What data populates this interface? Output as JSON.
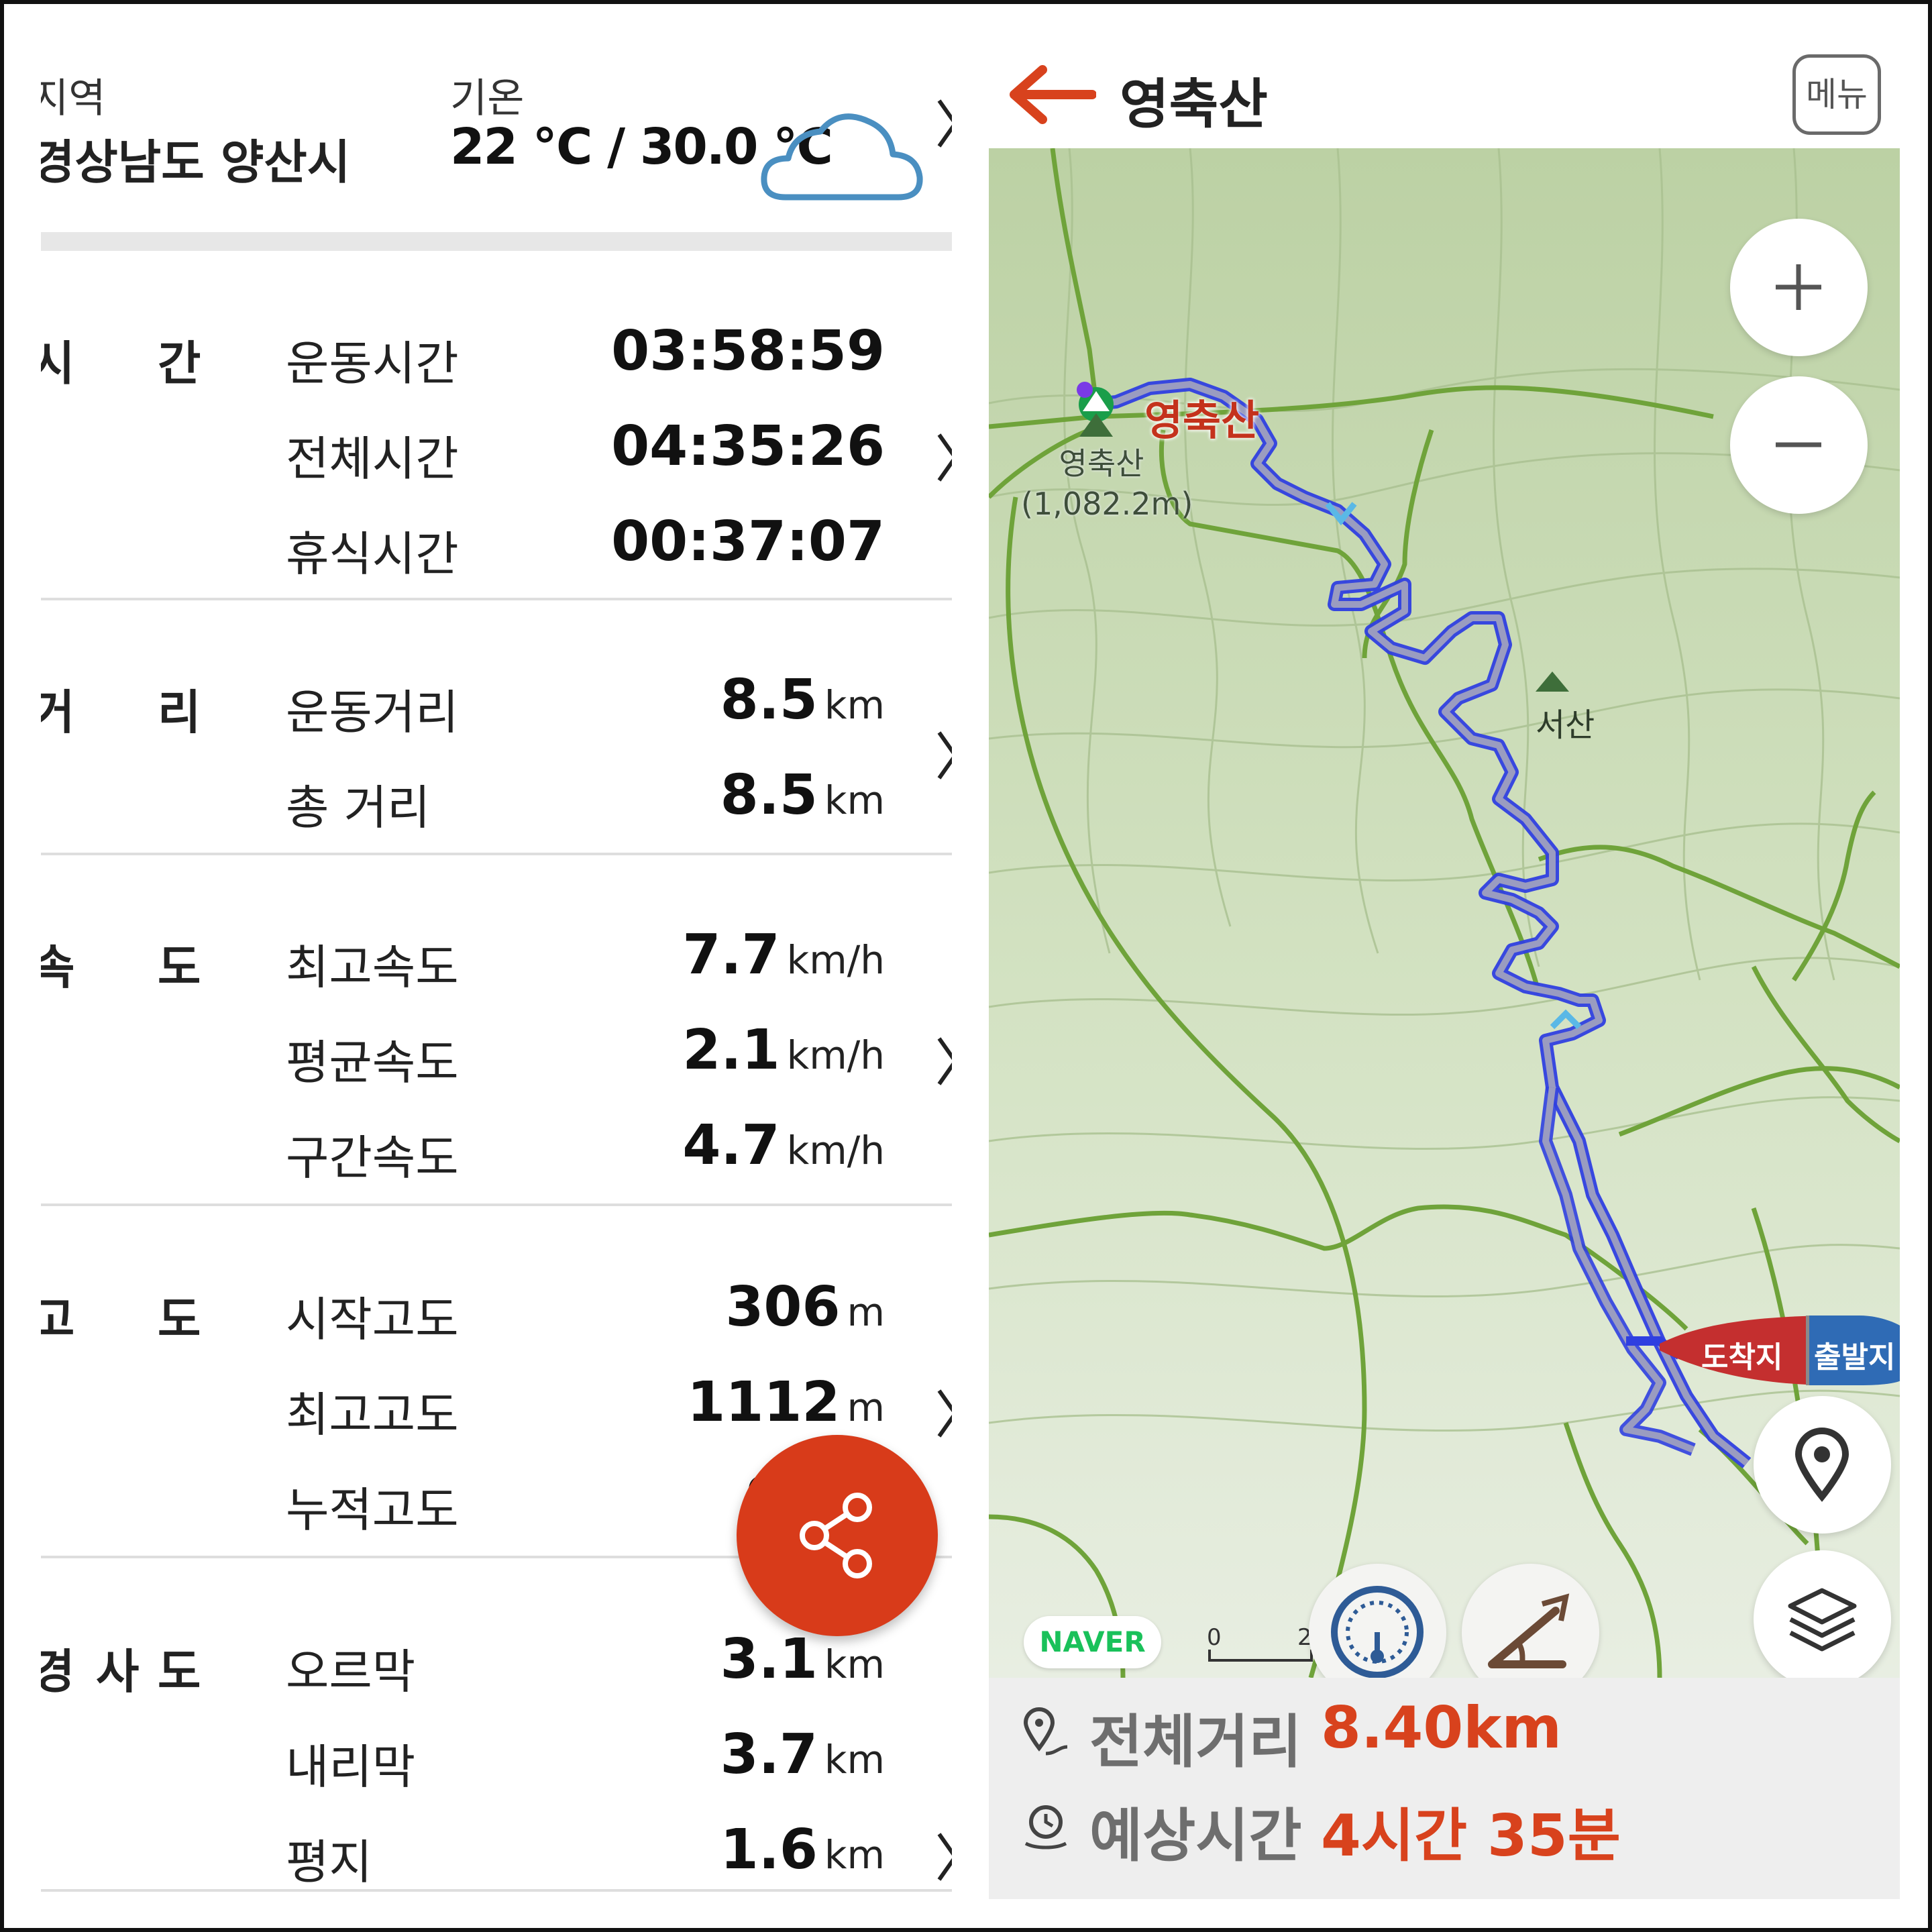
{
  "weather": {
    "region_label": "지역",
    "region_value": "경상남도 양산시",
    "temp_label": "기온",
    "temp_value": "22 ℃ / 30.0 ℃",
    "icon": "cloud-icon"
  },
  "sections": [
    {
      "title": [
        "시",
        "간"
      ],
      "rows": [
        {
          "label": "운동시간",
          "value": "03:58:59",
          "unit": ""
        },
        {
          "label": "전체시간",
          "value": "04:35:26",
          "unit": ""
        },
        {
          "label": "휴식시간",
          "value": "00:37:07",
          "unit": ""
        }
      ]
    },
    {
      "title": [
        "거",
        "리"
      ],
      "rows": [
        {
          "label": "운동거리",
          "value": "8.5",
          "unit": "km"
        },
        {
          "label": "총 거리",
          "value": "8.5",
          "unit": "km"
        }
      ]
    },
    {
      "title": [
        "속",
        "도"
      ],
      "rows": [
        {
          "label": "최고속도",
          "value": "7.7",
          "unit": "km/h"
        },
        {
          "label": "평균속도",
          "value": "2.1",
          "unit": "km/h"
        },
        {
          "label": "구간속도",
          "value": "4.7",
          "unit": "km/h"
        }
      ]
    },
    {
      "title": [
        "고",
        "도"
      ],
      "rows": [
        {
          "label": "시작고도",
          "value": "306",
          "unit": "m"
        },
        {
          "label": "최고고도",
          "value": "1112",
          "unit": "m"
        },
        {
          "label": "누적고도",
          "value": "9",
          "unit": ""
        }
      ]
    },
    {
      "title": [
        "경",
        "사",
        "도"
      ],
      "rows": [
        {
          "label": "오르막",
          "value": "3.1",
          "unit": "km"
        },
        {
          "label": "내리막",
          "value": "3.7",
          "unit": "km"
        },
        {
          "label": "평지",
          "value": "1.6",
          "unit": "km"
        }
      ]
    }
  ],
  "share_button": {
    "icon": "share-icon"
  },
  "map_header": {
    "title": "영축산",
    "menu_label": "메뉴",
    "back_icon": "back-arrow-icon"
  },
  "map": {
    "peak_name": "영축산",
    "peak_sub_name": "영축산",
    "peak_elevation": "(1,082.2m)",
    "peak2_name": "서산",
    "flag_arrive": "도착지",
    "flag_depart": "출발지",
    "naver_logo": "NAVER",
    "scale_start": "0",
    "scale_end": "2",
    "track_color": "#2f3fe0",
    "zoom_in_icon": "plus-icon",
    "zoom_out_icon": "minus-icon",
    "location_icon": "location-pin-icon",
    "layers_icon": "layers-icon",
    "speedometer_icon": "speedometer-icon",
    "slope_icon": "slope-icon"
  },
  "summary": {
    "distance_label": "전체거리",
    "distance_value": "8.40km",
    "time_label": "예상시간",
    "time_value": "4시간 35분"
  },
  "colors": {
    "accent": "#d83b1a",
    "summary_value": "#d8421d",
    "map_bg": "#c7d8b2",
    "contour": "#6fa33a"
  }
}
